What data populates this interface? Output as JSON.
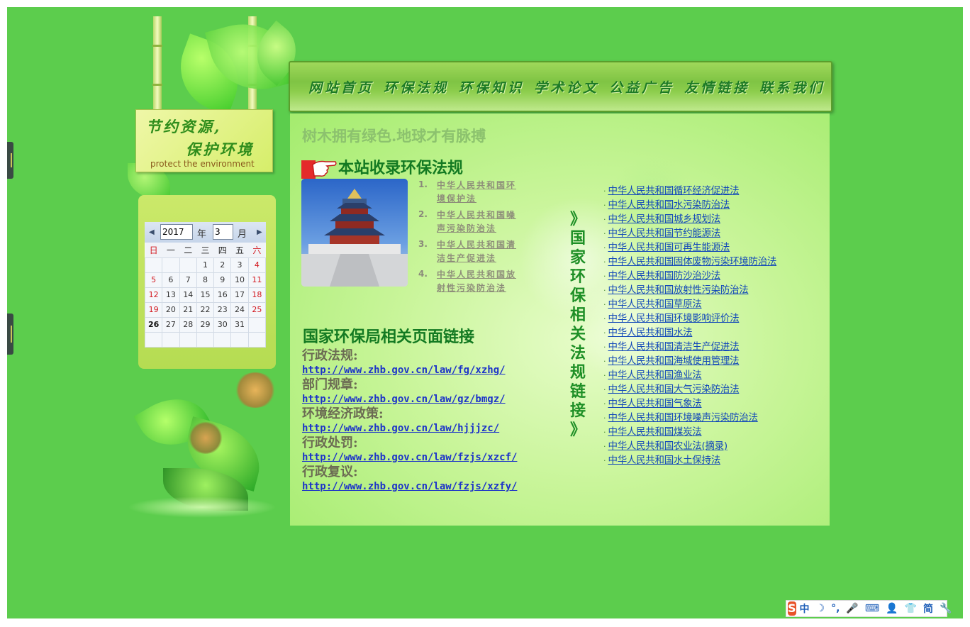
{
  "nav": {
    "items": [
      "网站首页",
      "环保法规",
      "环保知识",
      "学术论文",
      "公益广告",
      "友情链接",
      "联系我们"
    ]
  },
  "sign": {
    "line1": "节约资源,",
    "line2": "保护环境",
    "en": "protect the environment"
  },
  "calendar": {
    "year": "2017",
    "year_label": "年",
    "month": "3",
    "month_label": "月",
    "prev_icon": "triangle-left",
    "next_icon": "triangle-right",
    "weekdays": [
      "日",
      "一",
      "二",
      "三",
      "四",
      "五",
      "六"
    ],
    "weeks": [
      [
        "",
        "",
        "",
        "1",
        "2",
        "3",
        "4"
      ],
      [
        "5",
        "6",
        "7",
        "8",
        "9",
        "10",
        "11"
      ],
      [
        "12",
        "13",
        "14",
        "15",
        "16",
        "17",
        "18"
      ],
      [
        "19",
        "20",
        "21",
        "22",
        "23",
        "24",
        "25"
      ],
      [
        "26",
        "27",
        "28",
        "29",
        "30",
        "31",
        ""
      ],
      [
        "",
        "",
        "",
        "",
        "",
        "",
        ""
      ]
    ],
    "today": "26"
  },
  "main": {
    "slogan": "树木拥有绿色.地球才有脉搏",
    "laws_title": "本站收录环保法规",
    "featured_laws": [
      {
        "num": "1.",
        "lines": [
          "中华人民共和国环",
          "境保护法"
        ]
      },
      {
        "num": "2.",
        "lines": [
          "中华人民共和国噪",
          "声污染防治法"
        ]
      },
      {
        "num": "3.",
        "lines": [
          "中华人民共和国清",
          "洁生产促进法"
        ]
      },
      {
        "num": "4.",
        "lines": [
          "中华人民共和国放",
          "射性污染防治法"
        ]
      }
    ],
    "vertical_title": [
      "》",
      "国",
      "家",
      "环",
      "保",
      "相",
      "关",
      "法",
      "规",
      "链",
      "接",
      "》"
    ],
    "law_links": [
      "中华人民共和国循环经济促进法",
      "中华人民共和国水污染防治法",
      "中华人民共和国城乡规划法",
      "中华人民共和国节约能源法",
      "中华人民共和国可再生能源法",
      "中华人民共和国固体废物污染环境防治法",
      "中华人民共和国防沙治沙法",
      "中华人民共和国放射性污染防治法",
      "中华人民共和国草原法",
      "中华人民共和国环境影响评价法",
      "中华人民共和国水法",
      "中华人民共和国清洁生产促进法",
      "中华人民共和国海域使用管理法",
      "中华人民共和国渔业法",
      "中华人民共和国大气污染防治法",
      "中华人民共和国气象法",
      "中华人民共和国环境噪声污染防治法",
      "中华人民共和国煤炭法",
      "中华人民共和国农业法(摘录)",
      "中华人民共和国水土保持法"
    ],
    "link_bullet": "·",
    "epa_title": "国家环保局相关页面链接",
    "epa_links": [
      {
        "category": "行政法规:",
        "url": "http://www.zhb.gov.cn/law/fg/xzhg/"
      },
      {
        "category": "部门规章:",
        "url": "http://www.zhb.gov.cn/law/gz/bmgz/"
      },
      {
        "category": "环境经济政策:",
        "url": "http://www.zhb.gov.cn/law/hjjjzc/"
      },
      {
        "category": "行政处罚:",
        "url": "http://www.zhb.gov.cn/law/fzjs/xzcf/"
      },
      {
        "category": "行政复议:",
        "url": "http://www.zhb.gov.cn/law/fzjs/xzfy/"
      }
    ]
  },
  "ime": {
    "logo": "S",
    "items": [
      "中",
      "☽",
      "°,",
      "🎤",
      "⌨",
      "👤",
      "👕",
      "简",
      "🔧"
    ]
  },
  "colors": {
    "page_bg": "#5ccd4d",
    "panel": "#c9f59a",
    "heading": "#137a22",
    "link": "#1248b9"
  }
}
